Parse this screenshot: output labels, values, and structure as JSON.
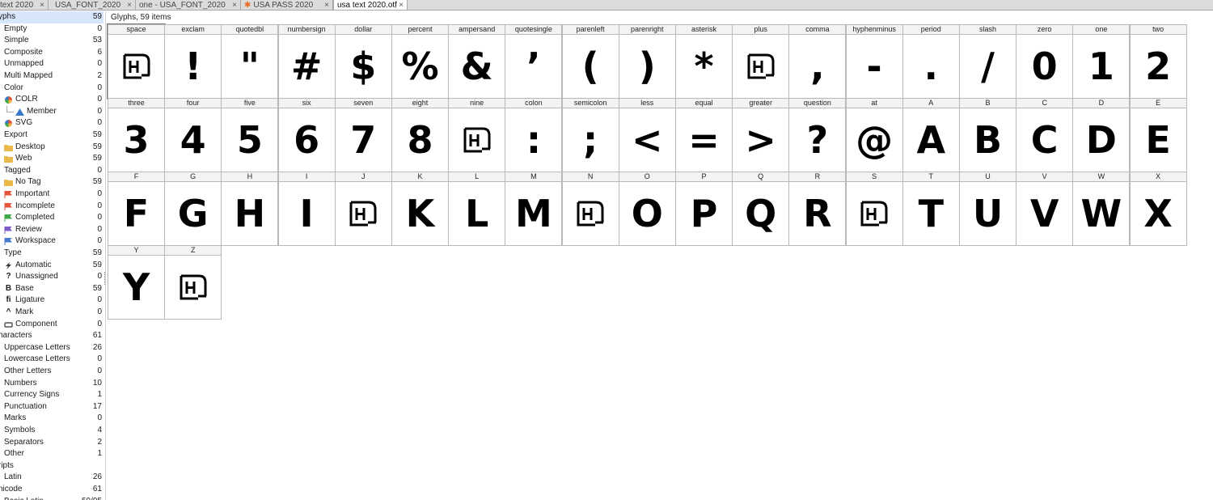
{
  "tabs": [
    {
      "label": "text 2020",
      "has_close": true,
      "active": false
    },
    {
      "label": "USA_FONT_2020",
      "has_close": true,
      "active": false
    },
    {
      "label": "one - USA_FONT_2020",
      "has_close": true,
      "active": false
    },
    {
      "label": "USA PASS 2020",
      "has_close": true,
      "active": false,
      "modified": true
    },
    {
      "label": "usa text 2020.otf",
      "has_close": true,
      "active": true
    }
  ],
  "sidebar": [
    {
      "label": "yphs",
      "count": "59",
      "indent": 0,
      "selected": true
    },
    {
      "label": "Empty",
      "count": "0",
      "indent": 1
    },
    {
      "label": "Simple",
      "count": "53",
      "indent": 1
    },
    {
      "label": "Composite",
      "count": "6",
      "indent": 1
    },
    {
      "label": "Unmapped",
      "count": "0",
      "indent": 1
    },
    {
      "label": "Multi Mapped",
      "count": "2",
      "indent": 1
    },
    {
      "label": "Color",
      "count": "0",
      "indent": 1
    },
    {
      "label": "COLR",
      "count": "0",
      "indent": 2,
      "icon": "color-wheel-icon"
    },
    {
      "label": "Member",
      "count": "0",
      "indent": 3,
      "icon": "triangle-icon"
    },
    {
      "label": "SVG",
      "count": "0",
      "indent": 2,
      "icon": "color-wheel-icon"
    },
    {
      "label": "Export",
      "count": "59",
      "indent": 1
    },
    {
      "label": "Desktop",
      "count": "59",
      "indent": 2,
      "icon": "folder-icon"
    },
    {
      "label": "Web",
      "count": "59",
      "indent": 2,
      "icon": "folder-icon"
    },
    {
      "label": "Tagged",
      "count": "0",
      "indent": 1
    },
    {
      "label": "No Tag",
      "count": "59",
      "indent": 2,
      "icon": "folder-icon"
    },
    {
      "label": "Important",
      "count": "0",
      "indent": 2,
      "icon": "flag-icon",
      "color": "#e5533a"
    },
    {
      "label": "Incomplete",
      "count": "0",
      "indent": 2,
      "icon": "flag-icon",
      "color": "#e5533a"
    },
    {
      "label": "Completed",
      "count": "0",
      "indent": 2,
      "icon": "flag-icon",
      "color": "#3ea845"
    },
    {
      "label": "Review",
      "count": "0",
      "indent": 2,
      "icon": "flag-icon",
      "color": "#7b5bc4"
    },
    {
      "label": "Workspace",
      "count": "0",
      "indent": 2,
      "icon": "flag-icon",
      "color": "#4a7bd0"
    },
    {
      "label": "Type",
      "count": "59",
      "indent": 1
    },
    {
      "label": "Automatic",
      "count": "59",
      "indent": 2,
      "icon": "lightning-icon"
    },
    {
      "label": "Unassigned",
      "count": "0",
      "indent": 2,
      "icon": "question-icon",
      "glyph": "?"
    },
    {
      "label": "Base",
      "count": "59",
      "indent": 2,
      "icon": "base-icon",
      "glyph": "B"
    },
    {
      "label": "Ligature",
      "count": "0",
      "indent": 2,
      "icon": "ligature-icon",
      "glyph": "fi"
    },
    {
      "label": "Mark",
      "count": "0",
      "indent": 2,
      "icon": "mark-icon",
      "glyph": "^"
    },
    {
      "label": "Component",
      "count": "0",
      "indent": 2,
      "icon": "component-icon"
    },
    {
      "label": "haracters",
      "count": "61",
      "indent": 0
    },
    {
      "label": "Uppercase Letters",
      "count": "26",
      "indent": 1
    },
    {
      "label": "Lowercase Letters",
      "count": "0",
      "indent": 1
    },
    {
      "label": "Other Letters",
      "count": "0",
      "indent": 1
    },
    {
      "label": "Numbers",
      "count": "10",
      "indent": 1
    },
    {
      "label": "Currency Signs",
      "count": "1",
      "indent": 1
    },
    {
      "label": "Punctuation",
      "count": "17",
      "indent": 1
    },
    {
      "label": "Marks",
      "count": "0",
      "indent": 1
    },
    {
      "label": "Symbols",
      "count": "4",
      "indent": 1
    },
    {
      "label": "Separators",
      "count": "2",
      "indent": 1
    },
    {
      "label": "Other",
      "count": "1",
      "indent": 1
    },
    {
      "label": "ripts",
      "count": "",
      "indent": 0
    },
    {
      "label": "Latin",
      "count": "26",
      "indent": 1
    },
    {
      "label": "nicode",
      "count": "61",
      "indent": 0
    },
    {
      "label": "Basic Latin",
      "count": "59/95",
      "indent": 1
    }
  ],
  "main": {
    "header": "Glyphs, 59 items"
  },
  "glyphs": [
    {
      "name": "space",
      "char": "",
      "placeholder": true,
      "selected": true
    },
    {
      "name": "exclam",
      "char": "!"
    },
    {
      "name": "quotedbl",
      "char": "\""
    },
    {
      "name": "numbersign",
      "char": "#"
    },
    {
      "name": "dollar",
      "char": "$"
    },
    {
      "name": "percent",
      "char": "%"
    },
    {
      "name": "ampersand",
      "char": "&"
    },
    {
      "name": "quotesingle",
      "char": "’"
    },
    {
      "name": "parenleft",
      "char": "("
    },
    {
      "name": "parenright",
      "char": ")"
    },
    {
      "name": "asterisk",
      "char": "*"
    },
    {
      "name": "plus",
      "char": "",
      "placeholder": true
    },
    {
      "name": "comma",
      "char": ","
    },
    {
      "name": "hyphenminus",
      "char": "-"
    },
    {
      "name": "period",
      "char": "."
    },
    {
      "name": "slash",
      "char": "/"
    },
    {
      "name": "zero",
      "char": "0"
    },
    {
      "name": "one",
      "char": "1"
    },
    {
      "name": "two",
      "char": "2"
    },
    {
      "name": "three",
      "char": "3"
    },
    {
      "name": "four",
      "char": "4"
    },
    {
      "name": "five",
      "char": "5"
    },
    {
      "name": "six",
      "char": "6"
    },
    {
      "name": "seven",
      "char": "7"
    },
    {
      "name": "eight",
      "char": "8"
    },
    {
      "name": "nine",
      "char": "",
      "placeholder": true
    },
    {
      "name": "colon",
      "char": ":"
    },
    {
      "name": "semicolon",
      "char": ";"
    },
    {
      "name": "less",
      "char": "<"
    },
    {
      "name": "equal",
      "char": "="
    },
    {
      "name": "greater",
      "char": ">"
    },
    {
      "name": "question",
      "char": "?"
    },
    {
      "name": "at",
      "char": "@"
    },
    {
      "name": "A",
      "char": "A"
    },
    {
      "name": "B",
      "char": "B"
    },
    {
      "name": "C",
      "char": "C"
    },
    {
      "name": "D",
      "char": "D"
    },
    {
      "name": "E",
      "char": "E"
    },
    {
      "name": "F",
      "char": "F"
    },
    {
      "name": "G",
      "char": "G"
    },
    {
      "name": "H",
      "char": "H"
    },
    {
      "name": "I",
      "char": "I"
    },
    {
      "name": "J",
      "char": "",
      "placeholder": true
    },
    {
      "name": "K",
      "char": "K"
    },
    {
      "name": "L",
      "char": "L"
    },
    {
      "name": "M",
      "char": "M"
    },
    {
      "name": "N",
      "char": "",
      "placeholder": true
    },
    {
      "name": "O",
      "char": "O"
    },
    {
      "name": "P",
      "char": "P"
    },
    {
      "name": "Q",
      "char": "Q"
    },
    {
      "name": "R",
      "char": "R"
    },
    {
      "name": "S",
      "char": "",
      "placeholder": true
    },
    {
      "name": "T",
      "char": "T"
    },
    {
      "name": "U",
      "char": "U"
    },
    {
      "name": "V",
      "char": "V"
    },
    {
      "name": "W",
      "char": "W"
    },
    {
      "name": "X",
      "char": "X"
    },
    {
      "name": "Y",
      "char": "Y"
    },
    {
      "name": "Z",
      "char": "",
      "placeholder": true
    }
  ],
  "colors": {
    "selection": "#d7e6fb",
    "folder": "#e9b94a",
    "triangle": "#3a78c9"
  }
}
